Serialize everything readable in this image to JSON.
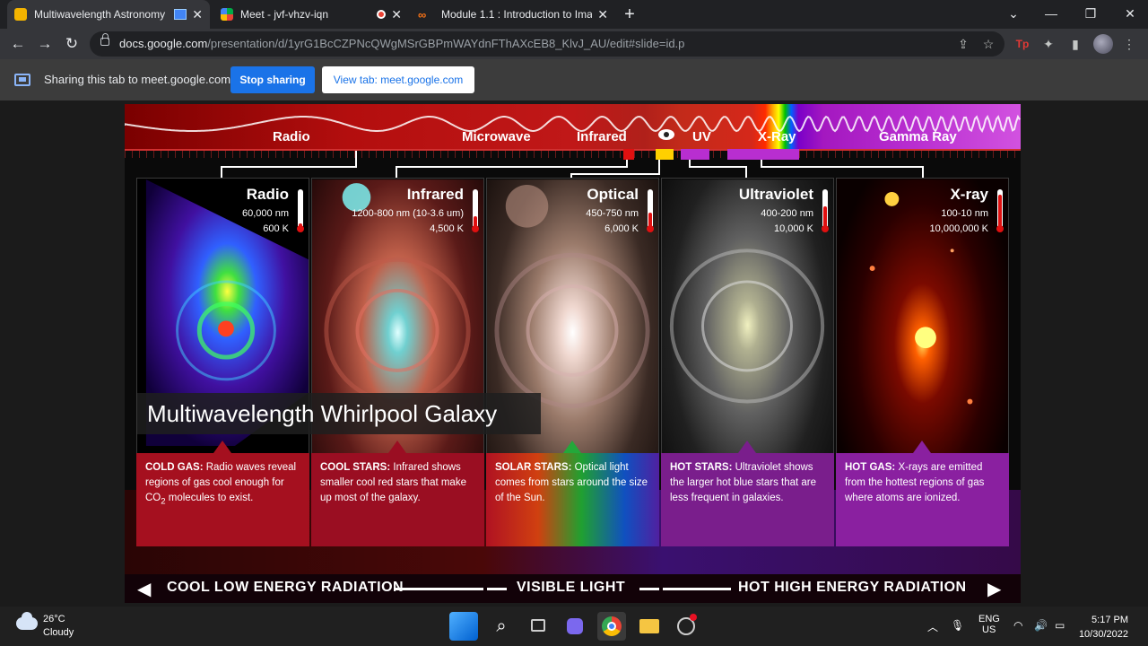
{
  "browser": {
    "tabs": [
      {
        "title": "Multiwavelength Astronomy",
        "active": true,
        "favicon_color": "#f4b400"
      },
      {
        "title": "Meet - jvf-vhzv-iqn",
        "active": false,
        "favicon_color": "#00ac47"
      },
      {
        "title": "Module 1.1 : Introduction to Ima",
        "active": false,
        "favicon_color": "#f97316"
      }
    ],
    "url_host": "docs.google.com",
    "url_path": "/presentation/d/1yrG1BcCZPNcQWgMSrGBPmWAYdnFThAXcEB8_KlvJ_AU/edit#slide=id.p",
    "extension_label": "Tp"
  },
  "sharebar": {
    "message": "Sharing this tab to meet.google.com",
    "stop_label": "Stop sharing",
    "view_label": "View tab: meet.google.com"
  },
  "slide": {
    "title": "Multiwavelength Whirlpool Galaxy",
    "spectrum_bands": [
      "Radio",
      "Microwave",
      "Infrared",
      "UV",
      "X-Ray",
      "Gamma Ray"
    ],
    "panels": [
      {
        "name": "Radio",
        "range": "60,000 nm",
        "temp": "600 K",
        "heading": "COLD GAS:",
        "desc_1": "Radio waves reveal regions of gas cool enough for CO",
        "sub": "2",
        "desc_2": " molecules to exist.",
        "accent": "#c4182a",
        "thermo": 0.15
      },
      {
        "name": "Infrared",
        "range": "1200-800 nm (10-3.6 um)",
        "temp": "4,500 K",
        "heading": "COOL STARS:",
        "desc_1": "Infrared shows smaller cool red stars that make up most of the galaxy.",
        "sub": "",
        "desc_2": "",
        "accent": "#b0132a",
        "thermo": 0.35
      },
      {
        "name": "Optical",
        "range": "450-750 nm",
        "temp": "6,000 K",
        "heading": "SOLAR STARS:",
        "desc_1": "Optical light comes from stars around the size of the Sun.",
        "sub": "",
        "desc_2": "",
        "accent": "#23a83a",
        "thermo": 0.45
      },
      {
        "name": "Ultraviolet",
        "range": "400-200 nm",
        "temp": "10,000 K",
        "heading": "HOT STARS:",
        "desc_1": "Ultraviolet shows the larger hot blue stars that are less frequent in galaxies.",
        "sub": "",
        "desc_2": "",
        "accent": "#8a2a9a",
        "thermo": 0.62
      },
      {
        "name": "X-ray",
        "range": "100-10 nm",
        "temp": "10,000,000 K",
        "heading": "HOT GAS:",
        "desc_1": "X-rays are emitted from the hottest regions of gas where atoms are ionized.",
        "sub": "",
        "desc_2": "",
        "accent": "#9a2ab0",
        "thermo": 0.95
      }
    ],
    "footer": {
      "left": "COOL LOW ENERGY RADIATION",
      "middle": "VISIBLE LIGHT",
      "right": "HOT HIGH ENERGY RADIATION"
    }
  },
  "taskbar": {
    "temperature": "26°C",
    "condition": "Cloudy",
    "language": "ENG",
    "region": "US",
    "time": "5:17 PM",
    "date": "10/30/2022"
  }
}
